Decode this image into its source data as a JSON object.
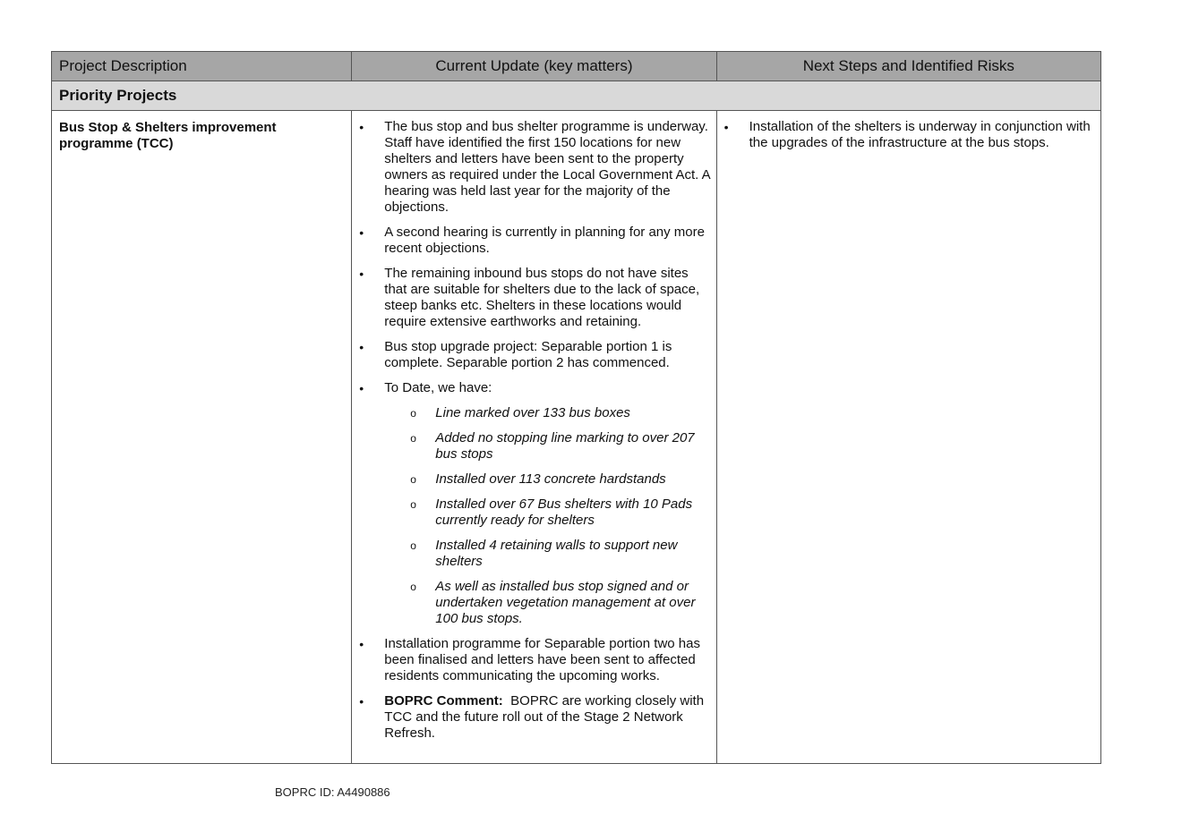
{
  "table": {
    "headers": [
      "Project Description",
      "Current Update (key matters)",
      "Next Steps and Identified Risks"
    ],
    "section_title": "Priority Projects",
    "project": {
      "title": "Bus Stop & Shelters improvement programme (TCC)",
      "current_update": [
        "The bus stop and bus shelter programme is underway. Staff have identified the first 150 locations for new shelters and letters have been sent to the property owners as required under the Local Government Act. A hearing was held last year for the majority of the objections.",
        "A second hearing is currently in planning for any more recent objections.",
        "The remaining inbound bus stops do not have sites that are suitable for shelters due to the lack of space, steep banks etc. Shelters in these locations would require extensive earthworks and retaining.",
        "Bus stop upgrade project: Separable portion 1 is complete. Separable portion 2 has commenced.",
        "To Date, we have:",
        "Installation programme for Separable portion two has been finalised and letters have been sent to affected residents communicating the upcoming works."
      ],
      "to_date_items": [
        "Line marked over 133 bus boxes",
        "Added no stopping line marking to over 207 bus stops",
        "Installed over 113 concrete hardstands",
        "Installed over 67 Bus shelters with 10 Pads currently ready for shelters",
        "Installed 4 retaining walls to support new shelters",
        "As well as installed bus stop signed and or undertaken vegetation management at over 100 bus stops."
      ],
      "comment_label": "BOPRC Comment:",
      "comment_text": "BOPRC are working closely with TCC and the future roll out of the Stage 2 Network Refresh.",
      "next_steps": [
        "Installation of the shelters is underway in conjunction with the upgrades of the infrastructure at the bus stops."
      ]
    }
  },
  "footer": {
    "doc_id": "BOPRC ID: A4490886"
  }
}
